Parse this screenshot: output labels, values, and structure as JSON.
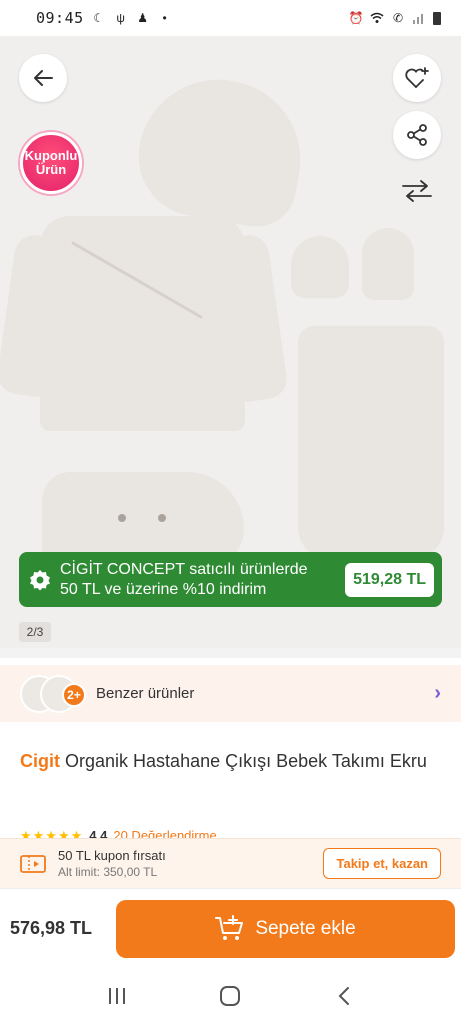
{
  "status_bar": {
    "time": "09:45",
    "left_icons": [
      "moon-icon",
      "usb-icon",
      "user-icon",
      "dot-icon"
    ],
    "right_icons": [
      "alarm-icon",
      "wifi-icon",
      "call-icon",
      "signal-icon",
      "battery-icon"
    ]
  },
  "hero": {
    "coupon_badge": {
      "line1": "Kuponlu",
      "line2": "Ürün"
    },
    "promo": {
      "line1": "CİGİT CONCEPT satıcılı ürünlerde",
      "line2": "50 TL ve üzerine %10 indirim",
      "price": "519,28 TL"
    },
    "page_indicator": "2/3"
  },
  "similar": {
    "label": "Benzer ürünler",
    "count_badge": "2+"
  },
  "product": {
    "brand": "Cigit",
    "name": "Organik Hastahane Çıkışı Bebek Takımı Ekru",
    "rating": "4.4",
    "reviews": "20 Değerlendirme"
  },
  "coupon": {
    "title": "50 TL kupon fırsatı",
    "subtitle": "Alt limit: 350,00 TL",
    "button": "Takip et, kazan"
  },
  "cart": {
    "price": "576,98 TL",
    "button": "Sepete ekle"
  },
  "colors": {
    "accent": "#f27a1a",
    "promo_green": "#2f8a34",
    "coupon_pink": "#e4226a"
  }
}
